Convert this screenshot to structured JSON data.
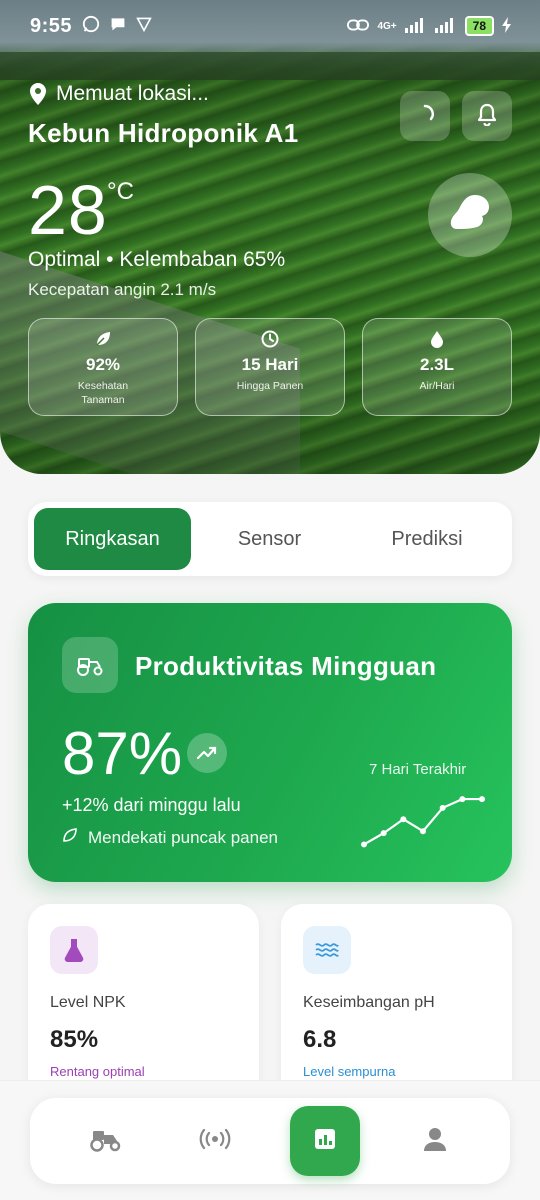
{
  "status_bar": {
    "time": "9:55",
    "network": "4G+",
    "battery": "78"
  },
  "header": {
    "location": "Memuat lokasi...",
    "farm_name": "Kebun Hidroponik A1",
    "temperature": "28",
    "temperature_unit": "°C",
    "condition": "Optimal  •  Kelembaban 65%",
    "wind": "Kecepatan angin 2.1 m/s"
  },
  "stats": [
    {
      "icon": "leaf-icon",
      "value": "92%",
      "label": "Kesehatan Tanaman"
    },
    {
      "icon": "clock-icon",
      "value": "15 Hari",
      "label": "Hingga Panen"
    },
    {
      "icon": "drop-icon",
      "value": "2.3L",
      "label": "Air/Hari"
    }
  ],
  "tabs": [
    {
      "label": "Ringkasan",
      "active": true
    },
    {
      "label": "Sensor",
      "active": false
    },
    {
      "label": "Prediksi",
      "active": false
    }
  ],
  "productivity": {
    "title": "Produktivitas Mingguan",
    "value": "87%",
    "change": "+12% dari minggu lalu",
    "note": "Mendekati puncak panen",
    "period": "7 Hari Terakhir",
    "trend": [
      0.12,
      0.3,
      0.52,
      0.33,
      0.7,
      0.84,
      0.84
    ]
  },
  "metrics": [
    {
      "icon": "flask-icon",
      "label": "Level NPK",
      "value": "85%",
      "sub": "Rentang optimal",
      "accent": "#9b3fb3"
    },
    {
      "icon": "waves-icon",
      "label": "Keseimbangan pH",
      "value": "6.8",
      "sub": "Level sempurna",
      "accent": "#2b8fd1"
    }
  ],
  "colors": {
    "primary": "#1f8a44",
    "nav_active": "#32a84e"
  },
  "nav": [
    {
      "icon": "tractor-icon",
      "active": false
    },
    {
      "icon": "sensor-icon",
      "active": false
    },
    {
      "icon": "chart-icon",
      "active": true
    },
    {
      "icon": "user-icon",
      "active": false
    }
  ]
}
